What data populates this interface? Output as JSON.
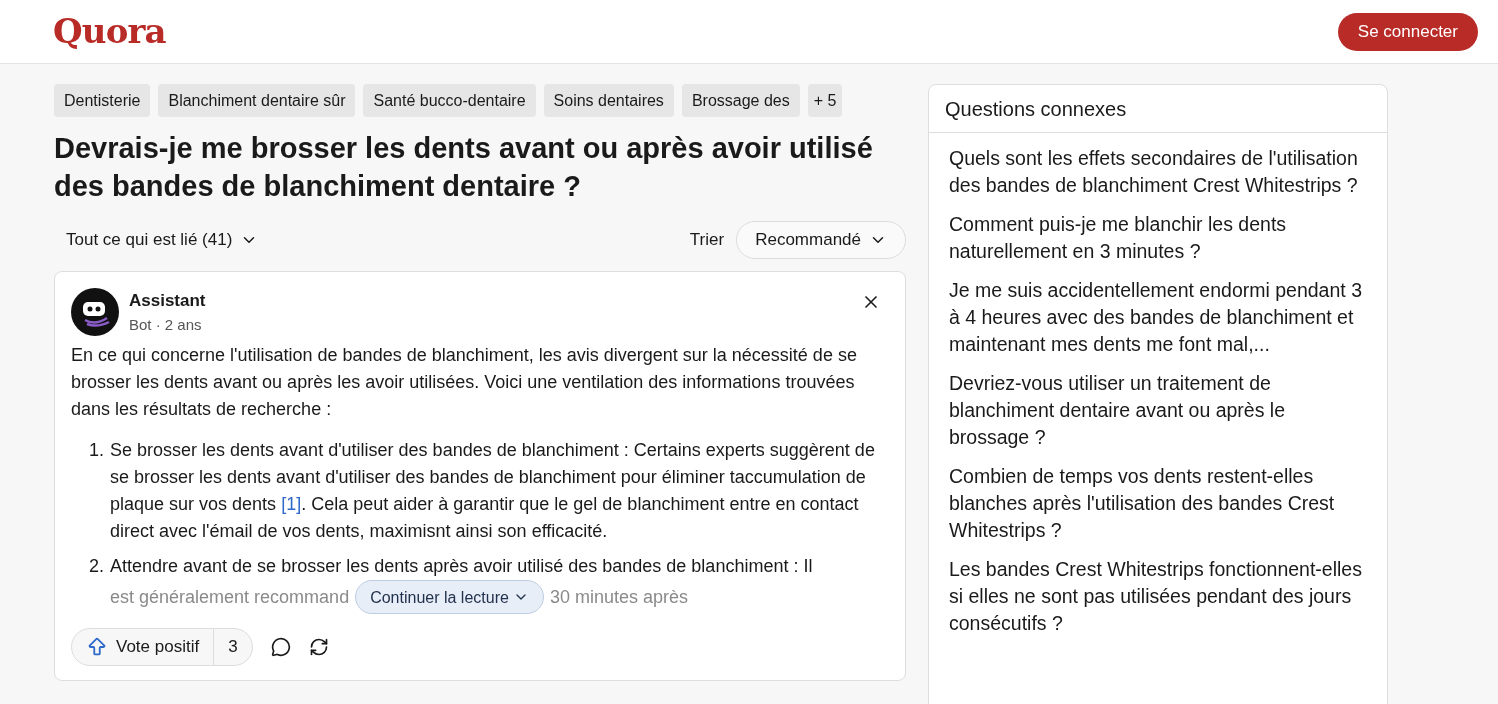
{
  "header": {
    "logo": "Quora",
    "login_button": "Se connecter"
  },
  "topics": [
    {
      "label": "Dentisterie"
    },
    {
      "label": "Blanchiment dentaire sûr"
    },
    {
      "label": "Santé bucco-dentaire"
    },
    {
      "label": "Soins dentaires"
    },
    {
      "label": "Brossage des"
    }
  ],
  "more_topics": "+ 5",
  "question": "Devrais-je me brosser les dents avant ou après avoir utilisé des bandes de blanchiment dentaire ?",
  "filter": {
    "label": "Tout ce qui est lié (41)",
    "sort_label": "Trier",
    "sort_value": "Recommandé"
  },
  "answer": {
    "author": "Assistant",
    "meta": "Bot · 2 ans",
    "intro": "En ce qui concerne l'utilisation de bandes de blanchiment, les avis divergent sur la nécessité de se brosser les dents avant ou après les avoir utilisées. Voici une ventilation des informations trouvées dans les résultats de recherche :",
    "items": [
      {
        "number": "1.",
        "text_before": "Se brosser les dents avant d'utiliser des bandes de blanchiment : Certains experts suggèrent de se brosser les dents avant d'utiliser des bandes de blanchiment pour éliminer taccumulation de plaque sur vos dents",
        "citation": "[1]",
        "text_after": ". Cela peut aider à garantir que le gel de blanchiment entre en contact direct avec l'émail de vos dents, maximisnt ainsi son efficacité."
      },
      {
        "number": "2.",
        "line_1": "Attendre avant de se brosser les dents après avoir utilisé des bandes de blanchiment : Il",
        "faded_before": "est généralement recommand",
        "faded_after": "30 minutes après"
      }
    ],
    "continue_button": "Continuer la lecture",
    "upvote_label": "Vote positif",
    "upvote_count": "3"
  },
  "related": {
    "title": "Questions connexes",
    "items": [
      "Quels sont les effets secondaires de l'utilisation des bandes de blanchiment Crest Whitestrips ?",
      "Comment puis-je me blanchir les dents naturellement en 3 minutes ?",
      "Je me suis accidentellement endormi pendant 3 à 4 heures avec des bandes de blanchiment et maintenant mes dents me font mal,...",
      "Devriez-vous utiliser un traitement de blanchiment dentaire avant ou après le brossage ?",
      "Combien de temps vos dents restent-elles blanches après l'utilisation des bandes Crest Whitestrips ?",
      "Les bandes Crest Whitestrips fonctionnent-elles si elles ne sont pas utilisées pendant des jours consécutifs ?"
    ]
  }
}
